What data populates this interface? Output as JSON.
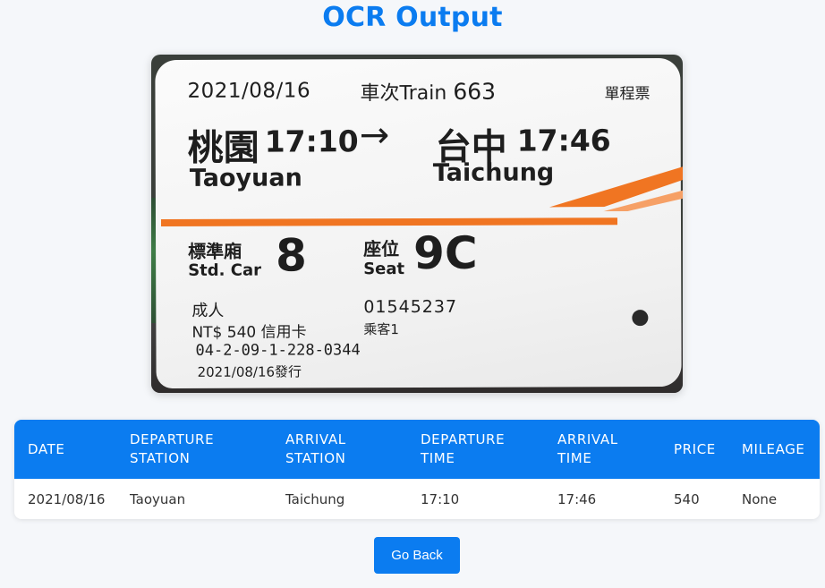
{
  "page": {
    "title": "OCR Output"
  },
  "ticket": {
    "date": "2021/08/16",
    "train_label": "車次Train",
    "train_number": "663",
    "ticket_type": "單程票",
    "from_zh": "桃園",
    "from_time": "17:10",
    "arrow": "→",
    "to_zh": "台中",
    "to_time": "17:46",
    "from_en": "Taoyuan",
    "to_en": "Taichung",
    "car_label_zh": "標準廂",
    "car_label_en": "Std. Car",
    "car_number": "8",
    "seat_label_zh": "座位",
    "seat_label_en": "Seat",
    "seat_number": "9C",
    "passenger_type": "成人",
    "price_line": "NT$ 540 信用卡",
    "code": "04-2-09-1-228-0344",
    "issued": "2021/08/16發行",
    "ticket_no": "01545237",
    "passenger_count": "乘客1",
    "stripe_color": "#f07522"
  },
  "table": {
    "headers": [
      [
        "DATE",
        ""
      ],
      [
        "DEPARTURE",
        "STATION"
      ],
      [
        "ARRIVAL",
        "STATION"
      ],
      [
        "DEPARTURE",
        "TIME"
      ],
      [
        "ARRIVAL",
        "TIME"
      ],
      [
        "PRICE",
        ""
      ],
      [
        "MILEAGE",
        ""
      ]
    ],
    "rows": [
      [
        "2021/08/16",
        "Taoyuan",
        "Taichung",
        "17:10",
        "17:46",
        "540",
        "None"
      ]
    ]
  },
  "actions": {
    "go_back_label": "Go Back"
  },
  "colors": {
    "accent": "#0b7cf0",
    "background": "#f5f7fa"
  }
}
